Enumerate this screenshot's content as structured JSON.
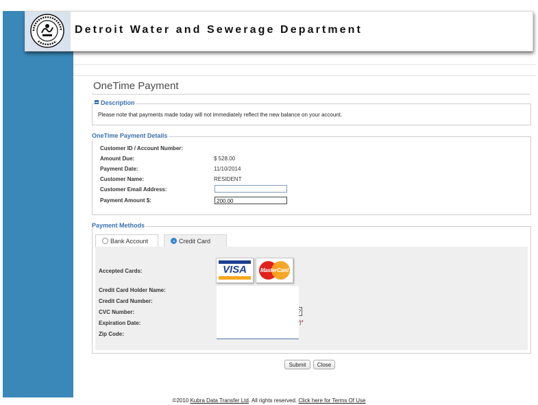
{
  "header": {
    "title": "Detroit Water and Sewerage Department",
    "seal_text": [
      "WATER & SEWERAGE",
      "DETROIT",
      "DEPT"
    ]
  },
  "page": {
    "title": "OneTime Payment"
  },
  "description": {
    "legend": "Description",
    "text": "Please note that payments made today will not immediately reflect the new balance on your account."
  },
  "details": {
    "legend": "OneTime Payment Details",
    "customer_id_label": "Customer ID / Account Number:",
    "customer_id_value": "",
    "amount_due_label": "Amount Due:",
    "amount_due_value": "$ 528.00",
    "payment_date_label": "Payment Date:",
    "payment_date_value": "11/10/2014",
    "customer_name_label": "Customer Name:",
    "customer_name_value": "RESIDENT",
    "email_label": "Customer Email Address:",
    "email_value": "",
    "payment_amount_label": "Payment Amount $:",
    "payment_amount_value": "200.00"
  },
  "payment_methods": {
    "legend": "Payment Methods",
    "tabs": [
      {
        "label": "Bank Account",
        "selected": false
      },
      {
        "label": "Credit Card",
        "selected": true
      }
    ],
    "accepted_cards_label": "Accepted Cards:",
    "cards": [
      "VISA",
      "MasterCard"
    ],
    "holder_name_label": "Credit Card Holder Name:",
    "card_number_label": "Credit Card Number:",
    "cvc_label": "CVC Number:",
    "cvc_help": "?",
    "expiration_label": "Expiration Date:",
    "expiration_hint": "y)",
    "required_mark": "*",
    "zip_label": "Zip Code:"
  },
  "buttons": {
    "submit": "Submit",
    "close": "Close"
  },
  "footer": {
    "prefix": "©2010 ",
    "company_link": "Kubra Data Transfer Ltd",
    "middle": ". All rights reserved. ",
    "terms_link": "Click here for Terms Of Use"
  },
  "colors": {
    "sidebar": "#3a88b8",
    "legend": "#3a6fb0",
    "panel": "#efefef"
  }
}
